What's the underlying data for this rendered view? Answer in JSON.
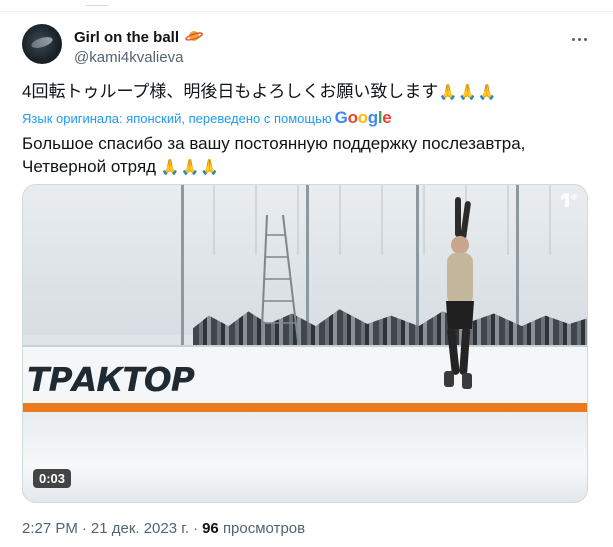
{
  "author": {
    "display_name": "Girl on the ball",
    "handle": "@kami4kvalieva",
    "verified_icon": "planet-icon",
    "avatar_icon": "avatar-photo"
  },
  "tweet": {
    "original_text": "4回転トゥループ様、明後日もよろしくお願い致します",
    "original_emoji": "🙏🙏🙏",
    "translated_by": "Язык оригинала: японский, переведено с помощью",
    "translation_line1": "Большое спасибо за вашу постоянную поддержку послезавтра,",
    "translation_line2": "Четверной отряд",
    "translation_emoji": "🙏🙏🙏"
  },
  "media": {
    "video_icon": "video-thumbnail",
    "logo_text": "ТРАКТОР",
    "duration": "0:03"
  },
  "meta": {
    "time": "2:27 PM",
    "date": "21 дек. 2023 г.",
    "separator": "·",
    "views_count": "96",
    "views_label": "просмотров"
  },
  "colors": {
    "accent": "#1d9bf0",
    "secondary_text": "#536471",
    "primary_text": "#0f1419"
  }
}
